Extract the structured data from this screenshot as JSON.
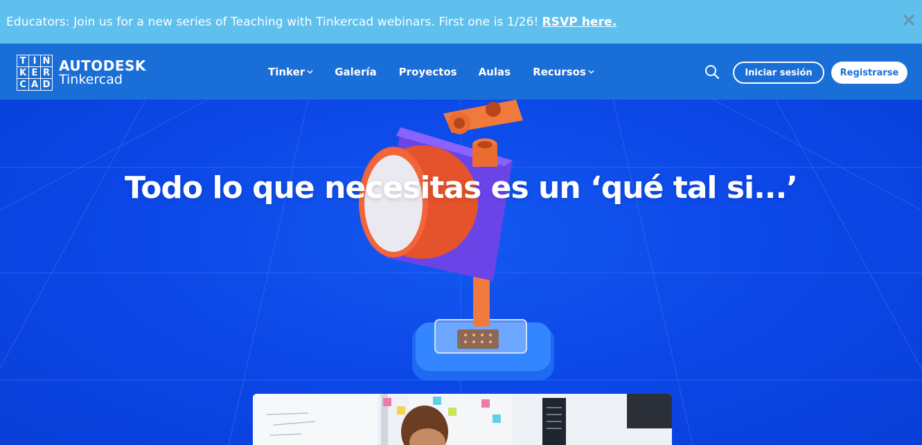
{
  "banner": {
    "message": "Educators: Join us for a new series of Teaching with Tinkercad webinars. First one is 1/26!",
    "link_label": "RSVP here."
  },
  "header": {
    "logo_letters": [
      "T",
      "I",
      "N",
      "K",
      "E",
      "R",
      "C",
      "A",
      "D"
    ],
    "brand": "AUTODESK",
    "product": "Tinkercad",
    "nav": {
      "tinker": "Tinker",
      "galeria": "Galería",
      "proyectos": "Proyectos",
      "aulas": "Aulas",
      "recursos": "Recursos"
    },
    "login_label": "Iniciar sesión",
    "register_label": "Registrarse"
  },
  "hero": {
    "title": "Todo lo que necesitas es un ‘qué tal si...’"
  },
  "colors": {
    "banner_bg": "#5fc0ee",
    "header_bg": "#1a6ed8",
    "hero_bg": "#0b46e6"
  }
}
